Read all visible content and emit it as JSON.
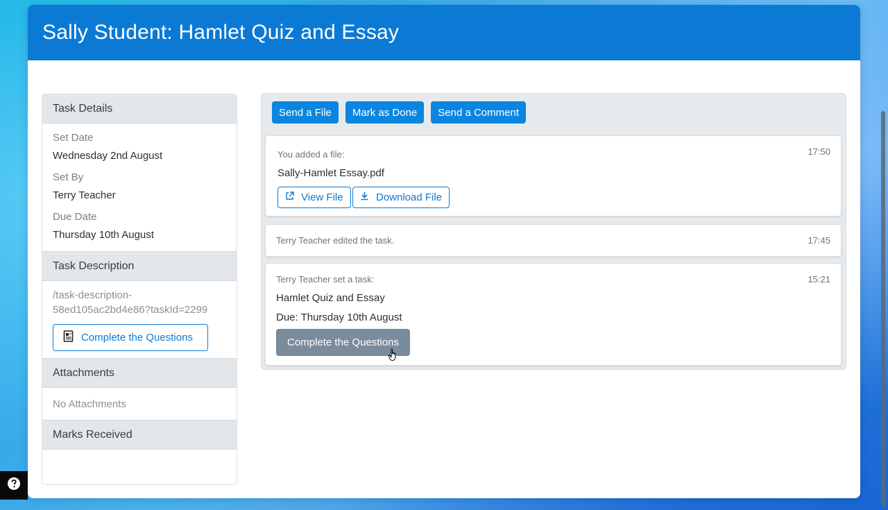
{
  "header": {
    "title": "Sally Student: Hamlet Quiz and Essay"
  },
  "colors": {
    "primary": "#0b7ad4",
    "secondary": "#7a8b9b",
    "panel": "#e4e7ea"
  },
  "sidebar": {
    "task_details": {
      "heading": "Task Details",
      "set_date_label": "Set Date",
      "set_date": "Wednesday 2nd August",
      "set_by_label": "Set By",
      "set_by": "Terry Teacher",
      "due_date_label": "Due Date",
      "due_date": "Thursday 10th August"
    },
    "task_description": {
      "heading": "Task Description",
      "path_line1": "/task-description-",
      "path_line2": "58ed105ac2bd4e86?taskId=2299",
      "button_label": "Complete the Questions",
      "button_icon": "document-icon"
    },
    "attachments": {
      "heading": "Attachments",
      "empty_text": "No Attachments"
    },
    "marks": {
      "heading": "Marks Received"
    }
  },
  "toolbar": {
    "send_file": "Send a File",
    "mark_done": "Mark as Done",
    "send_comment": "Send a Comment"
  },
  "feed": [
    {
      "meta": "You added a file:",
      "time": "17:50",
      "filename": "Sally-Hamlet Essay.pdf",
      "view_label": "View File",
      "view_icon": "external-link-icon",
      "download_label": "Download File",
      "download_icon": "download-icon"
    },
    {
      "meta": "Terry Teacher edited the task.",
      "time": "17:45"
    },
    {
      "meta": "Terry Teacher set a task:",
      "time": "15:21",
      "title": "Hamlet Quiz and Essay",
      "due": "Due: Thursday 10th August",
      "button_label": "Complete the Questions"
    }
  ],
  "help": {
    "icon": "question-circle-icon"
  }
}
